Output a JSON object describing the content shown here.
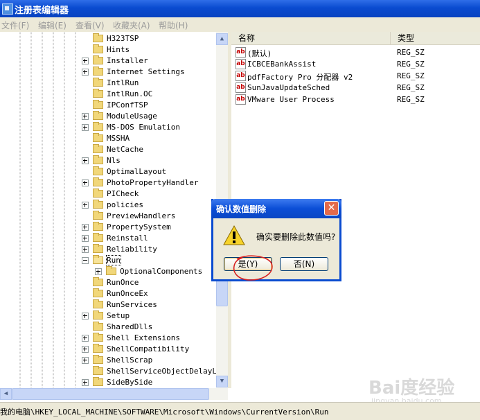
{
  "window": {
    "title": "注册表编辑器"
  },
  "menu": [
    "文件(F)",
    "编辑(E)",
    "查看(V)",
    "收藏夹(A)",
    "帮助(H)"
  ],
  "tree": {
    "items": [
      {
        "label": "H323TSP",
        "expander": "none"
      },
      {
        "label": "Hints",
        "expander": "none"
      },
      {
        "label": "Installer",
        "expander": "plus"
      },
      {
        "label": "Internet Settings",
        "expander": "plus"
      },
      {
        "label": "IntlRun",
        "expander": "none"
      },
      {
        "label": "IntlRun.OC",
        "expander": "none"
      },
      {
        "label": "IPConfTSP",
        "expander": "none"
      },
      {
        "label": "ModuleUsage",
        "expander": "plus"
      },
      {
        "label": "MS-DOS Emulation",
        "expander": "plus"
      },
      {
        "label": "MSSHA",
        "expander": "none"
      },
      {
        "label": "NetCache",
        "expander": "none"
      },
      {
        "label": "Nls",
        "expander": "plus"
      },
      {
        "label": "OptimalLayout",
        "expander": "none"
      },
      {
        "label": "PhotoPropertyHandler",
        "expander": "plus"
      },
      {
        "label": "PICheck",
        "expander": "none"
      },
      {
        "label": "policies",
        "expander": "plus"
      },
      {
        "label": "PreviewHandlers",
        "expander": "none"
      },
      {
        "label": "PropertySystem",
        "expander": "plus"
      },
      {
        "label": "Reinstall",
        "expander": "plus"
      },
      {
        "label": "Reliability",
        "expander": "plus"
      },
      {
        "label": "Run",
        "expander": "minus",
        "selected": true
      },
      {
        "label": "OptionalComponents",
        "expander": "plus",
        "child": true
      },
      {
        "label": "RunOnce",
        "expander": "none"
      },
      {
        "label": "RunOnceEx",
        "expander": "none"
      },
      {
        "label": "RunServices",
        "expander": "none"
      },
      {
        "label": "Setup",
        "expander": "plus"
      },
      {
        "label": "SharedDlls",
        "expander": "none"
      },
      {
        "label": "Shell Extensions",
        "expander": "plus"
      },
      {
        "label": "ShellCompatibility",
        "expander": "plus"
      },
      {
        "label": "ShellScrap",
        "expander": "plus"
      },
      {
        "label": "ShellServiceObjectDelayLoad",
        "expander": "none"
      },
      {
        "label": "SideBySide",
        "expander": "plus"
      }
    ]
  },
  "list": {
    "columns": {
      "name": "名称",
      "type": "类型"
    },
    "rows": [
      {
        "icon": "ab",
        "name": "(默认)",
        "type": "REG_SZ"
      },
      {
        "icon": "ab",
        "name": "ICBCEBankAssist",
        "type": "REG_SZ"
      },
      {
        "icon": "ab",
        "name": "pdfFactory Pro 分配器 v2",
        "type": "REG_SZ"
      },
      {
        "icon": "ab",
        "name": "SunJavaUpdateSched",
        "type": "REG_SZ"
      },
      {
        "icon": "ab",
        "name": "VMware User Process",
        "type": "REG_SZ"
      }
    ]
  },
  "status": {
    "path": "我的电脑\\HKEY_LOCAL_MACHINE\\SOFTWARE\\Microsoft\\Windows\\CurrentVersion\\Run"
  },
  "dialog": {
    "title": "确认数值删除",
    "message": "确实要删除此数值吗?",
    "yes_label": "是(Y)",
    "no_label": "否(N)",
    "close_glyph": "✕",
    "icon": "warning-icon"
  },
  "watermark": {
    "main": "Bai度经验",
    "sub": "jingyan.baidu.com"
  },
  "colors": {
    "title_blue": "#0a4bd0",
    "dialog_face": "#ece9d8",
    "annotation_red": "#d62020"
  }
}
